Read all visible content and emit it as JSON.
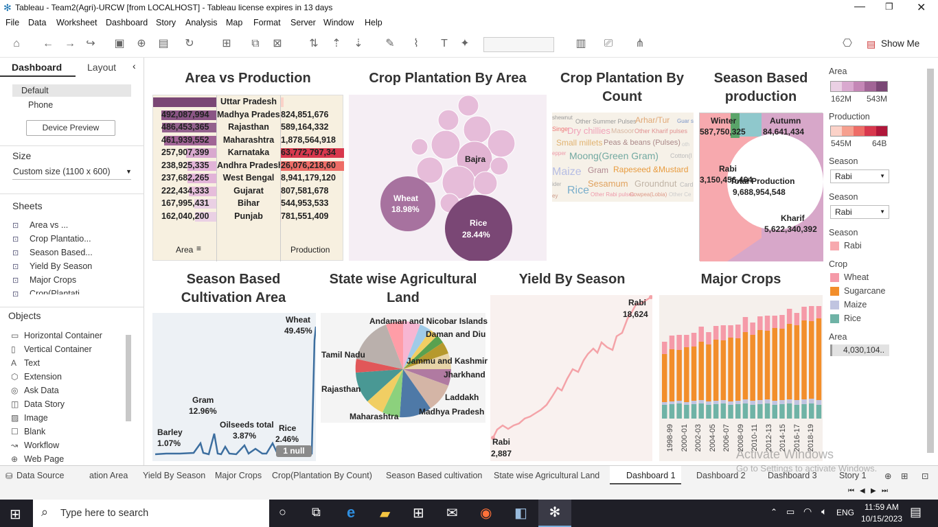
{
  "window": {
    "title": "Tableau - Team2(Agri)-URCW [from LOCALHOST] - Tableau license expires in 13 days"
  },
  "menu": [
    "File",
    "Data",
    "Worksheet",
    "Dashboard",
    "Story",
    "Analysis",
    "Map",
    "Format",
    "Server",
    "Window",
    "Help"
  ],
  "toolbar": {
    "show_me": "Show Me"
  },
  "left_pane": {
    "tab_dashboard": "Dashboard",
    "tab_layout": "Layout",
    "devices": [
      "Default",
      "Phone"
    ],
    "device_preview": "Device Preview",
    "size_heading": "Size",
    "size_value": "Custom size (1100 x 600)",
    "sheets_heading": "Sheets",
    "sheets": [
      "Area vs ...",
      "Crop Plantatio...",
      "Season Based...",
      "Yield By Season",
      "Major Crops",
      "Crop(Plantati..."
    ],
    "objects_heading": "Objects",
    "objects": [
      "Horizontal Container",
      "Vertical Container",
      "Text",
      "Extension",
      "Ask Data",
      "Data Story",
      "Image",
      "Blank",
      "Workflow",
      "Web Page"
    ]
  },
  "dashboard": {
    "titles": {
      "area_vs_production": "Area vs Production",
      "crop_by_area": "Crop Plantation By Area",
      "crop_by_count": "Crop Plantation By Count",
      "season_production": "Season Based production",
      "season_cultivation": "Season Based Cultivation Area",
      "state_land": "State wise Agricultural Land",
      "yield_by_season": "Yield By Season",
      "major_crops": "Major Crops"
    },
    "area_vs_production": {
      "states": [
        "Uttar Pradesh",
        "Madhya Pradesh",
        "Rajasthan",
        "Maharashtra",
        "Karnataka",
        "Andhra Pradesh",
        "West Bengal",
        "Gujarat",
        "Bihar",
        "Punjab"
      ],
      "area_labels": [
        "",
        "492,087,994",
        "486,453,365",
        "461,939,552",
        "257,907,399",
        "238,925,335",
        "237,682,265",
        "222,434,333",
        "167,995,431",
        "162,040,200"
      ],
      "production_labels": [
        "",
        "824,851,676",
        "589,164,332",
        "1,878,564,918",
        "63,772,797,34",
        "26,076,218,60",
        "8,941,179,120",
        "807,581,678",
        "544,953,533",
        "781,551,409"
      ],
      "area_header": "Area",
      "production_header": "Production"
    },
    "crop_by_area": {
      "bubbles": [
        {
          "name": "Bajra"
        },
        {
          "name": "Wheat",
          "pct": "18.98%"
        },
        {
          "name": "Rice",
          "pct": "28.44%"
        }
      ]
    },
    "crop_by_count": {
      "words": [
        "Other Summer Pulses",
        "Arhar/Tur",
        "Dry chillies",
        "Masoor",
        "Other Kharif pulses",
        "Small millets",
        "Peas & beans (Pulses)",
        "Moong(Green Gram)",
        "Cotton(l",
        "Maize",
        "Gram",
        "Rapeseed &Mustard",
        "Rice",
        "Sesamum",
        "Groundnut",
        "Card",
        "Other Rabi pulses",
        "Cowpea(Lobia)",
        "Other Ce",
        "Guar s",
        "shewnut",
        "Singer",
        "epper",
        "ider",
        "ey",
        "oth"
      ]
    },
    "season_production": {
      "segments": [
        {
          "name": "Winter",
          "value": "587,750,325"
        },
        {
          "name": "Autumn",
          "value": "84,641,434"
        },
        {
          "name": "Rabi",
          "value": "3,150,456,464"
        },
        {
          "name": "Kharif",
          "value": "5,622,340,392"
        }
      ],
      "total_label": "Total Production",
      "total_value": "9,688,954,548"
    },
    "season_cultivation": {
      "labels": [
        {
          "name": "Wheat",
          "pct": "49.45%"
        },
        {
          "name": "Gram",
          "pct": "12.96%"
        },
        {
          "name": "Barley",
          "pct": "1.07%"
        },
        {
          "name": "Oilseeds total",
          "pct": "3.87%"
        },
        {
          "name": "Rice",
          "pct": "2.46%"
        }
      ],
      "null_badge": "1 null"
    },
    "state_land": {
      "labels": [
        "Andaman and Nicobar Islands",
        "Daman and Diu",
        "Tamil Nadu",
        "Jammu and Kashmir",
        "Jharkhand",
        "Rajasthan",
        "Laddakh",
        "Maharashtra",
        "Madhya Pradesh"
      ]
    },
    "yield_by_season": {
      "end_label": "Rabi",
      "end_value": "18,624",
      "start_label": "Rabi",
      "start_value": "2,887"
    },
    "major_crops": {
      "years": [
        "1998-99",
        "2000-01",
        "2002-03",
        "2004-05",
        "2006-07",
        "2008-09",
        "2010-11",
        "2012-13",
        "2014-15",
        "2016-17",
        "2018-19"
      ]
    }
  },
  "legends": {
    "area_title": "Area",
    "area_min": "162M",
    "area_max": "543M",
    "production_title": "Production",
    "production_min": "545M",
    "production_max": "64B",
    "season1_title": "Season",
    "season1_value": "Rabi",
    "season2_title": "Season",
    "season2_value": "Rabi",
    "season3_title": "Season",
    "season3_item": "Rabi",
    "crop_title": "Crop",
    "crops": [
      {
        "name": "Wheat",
        "color": "#f59aa8"
      },
      {
        "name": "Sugarcane",
        "color": "#f28e2b"
      },
      {
        "name": "Maize",
        "color": "#c0c4e0"
      },
      {
        "name": "Rice",
        "color": "#6fb3a6"
      }
    ],
    "area2_title": "Area",
    "area2_value": "4,030,104.."
  },
  "sheet_tabs": [
    "Data Source",
    "ation Area",
    "Yield By Season",
    "Major Crops",
    "Crop(Plantation By Count)",
    "Season Based cultivation",
    "State wise Agricultural Land",
    "Dashboard 1",
    "Dashboard 2",
    "Dashboard 3",
    "Story 1"
  ],
  "watermark": {
    "line1": "Activate Windows",
    "line2": "Go to Settings to activate Windows."
  },
  "taskbar": {
    "search_placeholder": "Type here to search",
    "time": "11:59 AM",
    "date": "10/15/2023",
    "lang": "ENG"
  }
}
